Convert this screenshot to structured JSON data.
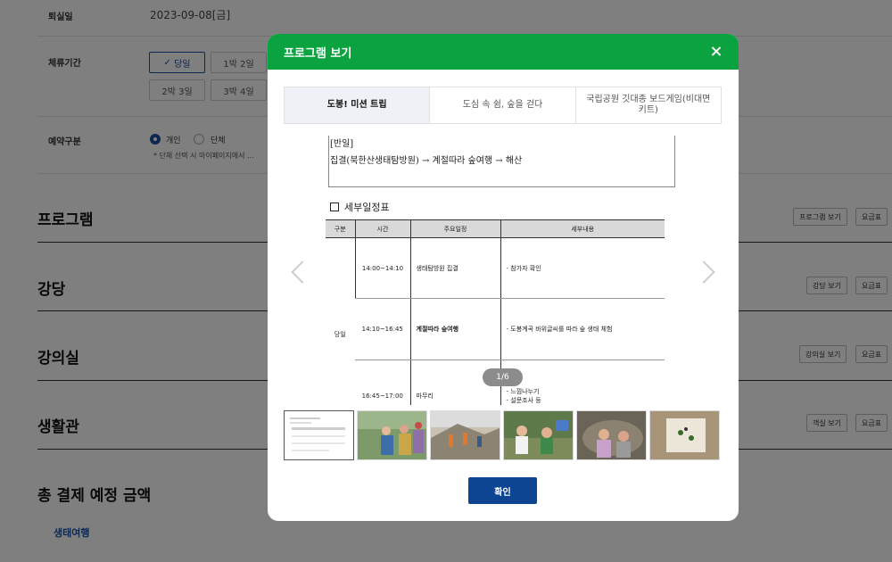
{
  "background": {
    "checkout": {
      "label": "퇴실일",
      "value": "2023-09-08[금]"
    },
    "stay": {
      "label": "체류기간",
      "options": [
        "당일",
        "1박 2일",
        "2박 3일",
        "3박 4일"
      ]
    },
    "reservation": {
      "label": "예약구분",
      "options": [
        "개인",
        "단체"
      ],
      "note": "* 단체 선택 시 마이페이지에서 ..."
    },
    "sections": [
      {
        "title": "프로그램",
        "buttons": [
          "프로그램 보기",
          "요금표"
        ]
      },
      {
        "title": "강당",
        "buttons": [
          "강당 보기",
          "요금표"
        ]
      },
      {
        "title": "강의실",
        "buttons": [
          "강의실 보기",
          "요금표"
        ]
      },
      {
        "title": "생활관",
        "buttons": [
          "객실 보기",
          "요금표"
        ]
      }
    ],
    "total_title": "총 결제 예정 금액",
    "link": "생태여행"
  },
  "modal": {
    "title": "프로그램 보기",
    "tabs": [
      "도봉! 미션 트립",
      "도심 속 쉼, 숲을 걷다",
      "국립공원 깃대종 보드게임(비대면 키트)"
    ],
    "document": {
      "line1": "[반일]",
      "line2": "집결(북한산생태탐방원) → 계절따라 숲여행 →  해산",
      "schedule_title": "세부일정표",
      "headers": [
        "구분",
        "시간",
        "주요일정",
        "세부내용"
      ],
      "day": "당일",
      "rows": [
        {
          "time": "14:00~14:10",
          "event": "생태탐방원 집결",
          "detail": "- 참가자 확인"
        },
        {
          "time": "14:10~16:45",
          "event": "계절따라 숲여행",
          "detail": "- 도봉계곡 바위글씨를 따라 숲 생태 체험"
        },
        {
          "time": "16:45~17:00",
          "event": "마무리",
          "detail": "- 느낌나누기\n- 설문조사 등"
        }
      ]
    },
    "counter": "1/6",
    "confirm_label": "확인"
  },
  "colors": {
    "header_green": "#0aa340",
    "confirm_blue": "#0d4593",
    "accent_blue": "#1a4ea1"
  }
}
